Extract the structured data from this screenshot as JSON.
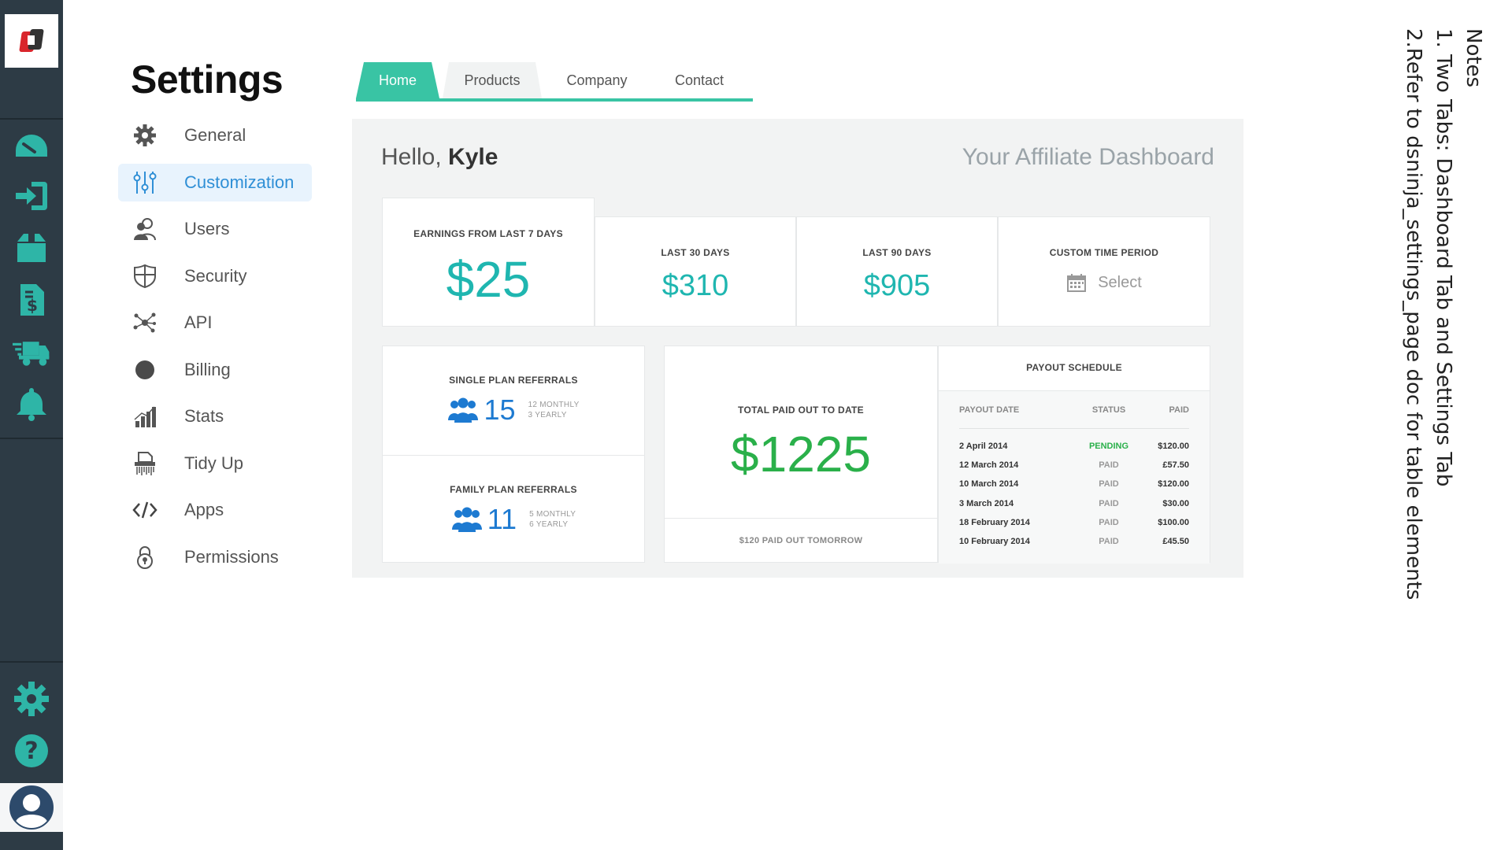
{
  "rail": {
    "icons": [
      "speedometer-icon",
      "sign-in-icon",
      "box-icon",
      "invoice-icon",
      "delivery-truck-icon",
      "bell-icon"
    ],
    "bottom_icons": [
      "gear-icon",
      "help-icon"
    ],
    "avatar": "user-avatar-icon",
    "colors": {
      "bg": "#2d3b45",
      "icon": "#2eb5a7",
      "bottom_icon": "#2eb5a7"
    }
  },
  "settings": {
    "title": "Settings",
    "items": [
      {
        "label": "General",
        "icon": "gear-icon"
      },
      {
        "label": "Customization",
        "icon": "sliders-icon",
        "active": true
      },
      {
        "label": "Users",
        "icon": "users-icon"
      },
      {
        "label": "Security",
        "icon": "shield-icon"
      },
      {
        "label": "API",
        "icon": "network-icon"
      },
      {
        "label": "Billing",
        "icon": "circle-icon"
      },
      {
        "label": "Stats",
        "icon": "bar-chart-icon"
      },
      {
        "label": "Tidy Up",
        "icon": "shredder-icon"
      },
      {
        "label": "Apps",
        "icon": "code-icon"
      },
      {
        "label": "Permissions",
        "icon": "lock-icon"
      }
    ]
  },
  "tabs": [
    "Home",
    "Products",
    "Company",
    "Contact"
  ],
  "dashboard": {
    "greeting_prefix": "Hello,",
    "user_name": "Kyle",
    "title": "Your Affiliate Dashboard",
    "earnings": [
      {
        "caption": "EARNINGS FROM LAST 7 DAYS",
        "value": "$25"
      },
      {
        "caption": "LAST 30 DAYS",
        "value": "$310"
      },
      {
        "caption": "LAST 90 DAYS",
        "value": "$905"
      }
    ],
    "custom_period": {
      "caption": "CUSTOM TIME PERIOD",
      "select_label": "Select"
    },
    "single_referrals": {
      "caption": "SINGLE PLAN REFERRALS",
      "count": "15",
      "monthly": "12 MONTHLY",
      "yearly": "3 YEARLY"
    },
    "family_referrals": {
      "caption": "FAMILY PLAN REFERRALS",
      "count": "11",
      "monthly": "5 MONTHLY",
      "yearly": "6 YEARLY"
    },
    "total": {
      "caption": "TOTAL PAID OUT TO DATE",
      "value": "$1225",
      "footer": "$120 PAID OUT TOMORROW"
    },
    "payout": {
      "caption": "PAYOUT SCHEDULE",
      "headers": [
        "PAYOUT DATE",
        "STATUS",
        "PAID"
      ],
      "rows": [
        {
          "date": "2 April 2014",
          "status": "PENDING",
          "paid": "$120.00"
        },
        {
          "date": "12 March 2014",
          "status": "PAID",
          "paid": "£57.50"
        },
        {
          "date": "10 March 2014",
          "status": "PAID",
          "paid": "$120.00"
        },
        {
          "date": "3 March 2014",
          "status": "PAID",
          "paid": "$30.00"
        },
        {
          "date": "18 February 2014",
          "status": "PAID",
          "paid": "$100.00"
        },
        {
          "date": "10 February 2014",
          "status": "PAID",
          "paid": "£45.50"
        }
      ]
    },
    "colors": {
      "accent": "#39c4a4",
      "earnings": "#1fb6b0",
      "total": "#2ab04a",
      "referral": "#1d7ad1"
    }
  },
  "notes": {
    "title": "Notes",
    "lines": [
      "1. Two Tabs: Dashboard Tab and Settings Tab",
      "2.Refer to dsninja_settings_page doc for table elements"
    ]
  }
}
